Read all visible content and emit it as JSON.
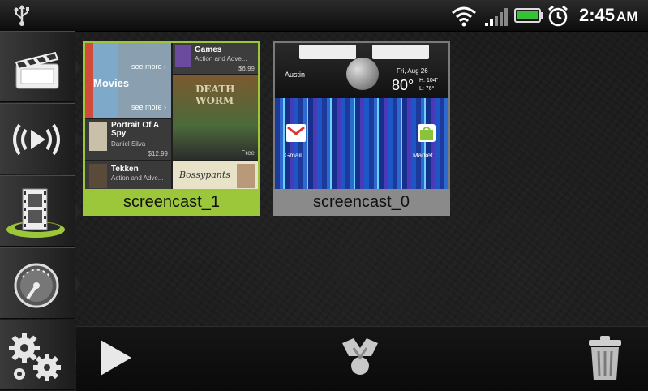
{
  "status_bar": {
    "time": "2:45",
    "ampm": "AM",
    "icons": [
      "usb-icon",
      "wifi-icon",
      "signal-icon",
      "battery-icon",
      "alarm-icon"
    ]
  },
  "sidebar": {
    "tabs": [
      {
        "name": "movies-tab",
        "icon": "clapperboard-icon",
        "selected": false
      },
      {
        "name": "streaming-tab",
        "icon": "broadcast-play-icon",
        "selected": false
      },
      {
        "name": "videos-tab",
        "icon": "film-strip-icon",
        "selected": true
      },
      {
        "name": "speed-tab",
        "icon": "gauge-icon",
        "selected": false
      },
      {
        "name": "settings-tab",
        "icon": "gears-icon",
        "selected": false
      }
    ]
  },
  "thumbnails": [
    {
      "caption": "screencast_1",
      "selected": true,
      "preview": {
        "see_more_1": "see more ›",
        "movies_label": "Movies",
        "see_more_2": "see more ›",
        "games_title": "Games",
        "games_sub": "Action and Adve...",
        "games_price": "$6.99",
        "book_title": "Portrait Of A Spy",
        "book_author": "Daniel Silva",
        "book_price": "$12.99",
        "death_title": "DEATH WORM",
        "death_price": "Free",
        "tekken_title": "Tekken",
        "tekken_sub": "Action and Adve...",
        "bossy_title": "Bossypants"
      }
    },
    {
      "caption": "screencast_0",
      "selected": false,
      "preview": {
        "city": "Austin",
        "date": "Fri, Aug 26",
        "temp": "80°",
        "hi": "H: 104°",
        "lo": "L: 76°",
        "app_1": "Gmail",
        "app_2": "Market"
      }
    }
  ],
  "toolbar": {
    "play_icon": "play-icon",
    "share_icon": "share-icon",
    "delete_icon": "trash-icon"
  },
  "colors": {
    "selected_accent": "#9cc73a",
    "unselected_frame": "#8a8a8a",
    "background": "#1a1a1a"
  }
}
